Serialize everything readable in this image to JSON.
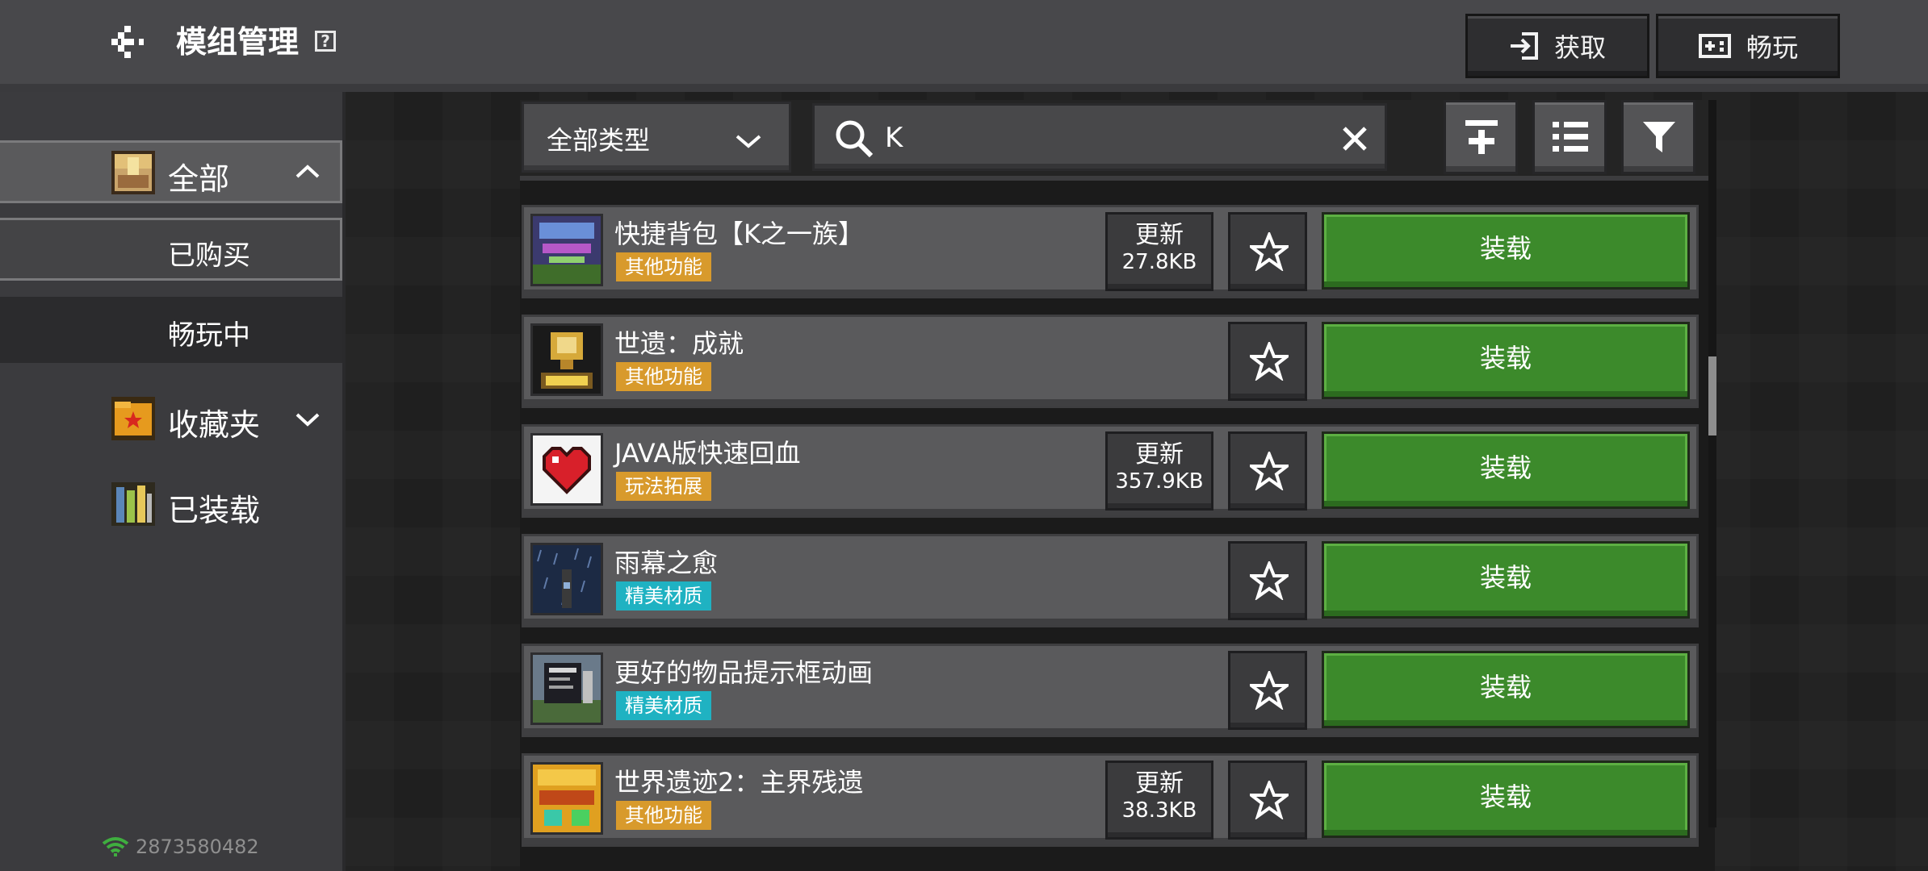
{
  "header": {
    "title": "模组管理",
    "help_icon": "?",
    "get_label": "获取",
    "play_label": "畅玩"
  },
  "sidebar": {
    "all_label": "全部",
    "purchased_label": "已购买",
    "playing_label": "畅玩中",
    "favorites_label": "收藏夹",
    "installed_label": "已装载",
    "user_id": "2873580482"
  },
  "toolbar": {
    "type_filter": "全部类型",
    "search_value": "K"
  },
  "mods": [
    {
      "name": "快捷背包【K之一族】",
      "tag": "其他功能",
      "tag_color": "#d89a2c",
      "update": "更新",
      "size": "27.8KB",
      "action": "装载"
    },
    {
      "name": "世遗：成就",
      "tag": "其他功能",
      "tag_color": "#d89a2c",
      "action": "装载"
    },
    {
      "name": "JAVA版快速回血",
      "tag": "玩法拓展",
      "tag_color": "#d89a2c",
      "update": "更新",
      "size": "357.9KB",
      "action": "装载"
    },
    {
      "name": "雨幕之愈",
      "tag": "精美材质",
      "tag_color": "#1fb2c2",
      "action": "装载"
    },
    {
      "name": "更好的物品提示框动画",
      "tag": "精美材质",
      "tag_color": "#1fb2c2",
      "action": "装载"
    },
    {
      "name": "世界遗迹2：主界残遗",
      "tag": "其他功能",
      "tag_color": "#d89a2c",
      "update": "更新",
      "size": "38.3KB",
      "action": "装载"
    }
  ],
  "colors": {
    "load_green": "#3c8a2b",
    "tag_orange": "#d89a2c",
    "tag_cyan": "#1fb2c2"
  }
}
